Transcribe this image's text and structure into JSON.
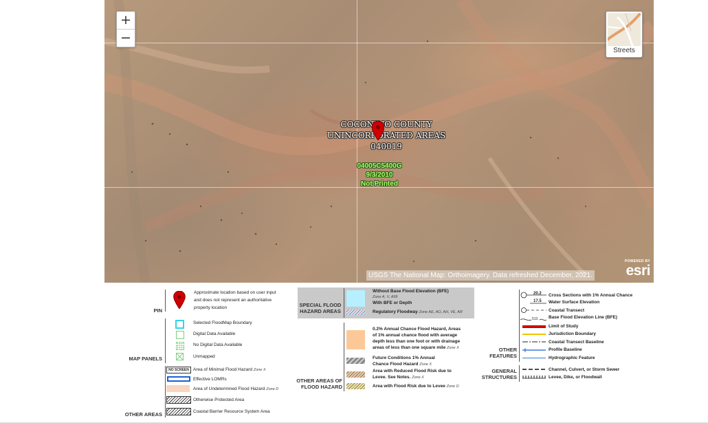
{
  "map": {
    "zoom_in": "+",
    "zoom_out": "−",
    "basemap_toggle_label": "Streets",
    "county_label": [
      "COCONINO COUNTY",
      "UNINCORPORATED AREAS",
      "040019"
    ],
    "panel_label": [
      "04005C5400G",
      "9/3/2010",
      "Not Printed"
    ],
    "attribution": "USGS The National Map: Orthoimagery. Data refreshed December, 2021.",
    "esri_powered_by": "POWERED BY",
    "esri_wordmark": "esri"
  },
  "legend": {
    "pin": {
      "section": "PIN",
      "text": [
        "Approximate location based on user input",
        "and does not represent an authoritative",
        "property location"
      ]
    },
    "map_panels": {
      "section": "MAP PANELS",
      "items": [
        "Selected FloodMap Boundary",
        "Digital Data Available",
        "No Digital Data Available",
        "Unmapped"
      ]
    },
    "other_areas": {
      "section": "OTHER AREAS",
      "no_screen_label": "NO SCREEN",
      "items": [
        {
          "text": "Area of Minimal Flood Hazard",
          "zone": "Zone X"
        },
        {
          "text": "Effective LOMRs",
          "zone": ""
        },
        {
          "text": "Area of Undetermined Flood Hazard",
          "zone": "Zone D"
        },
        {
          "text": "Otherwise Protected Area",
          "zone": ""
        },
        {
          "text": "Coastal Barrier Resource System Area",
          "zone": ""
        }
      ]
    },
    "special_flood": {
      "section": [
        "SPECIAL FLOOD",
        "HAZARD AREAS"
      ],
      "items": [
        {
          "text": "Without Base Flood Elevation (BFE)",
          "zone": "Zone A, V, A99"
        },
        {
          "text": "With BFE or Depth",
          "zone": ""
        },
        {
          "text": "Regulatory Floodway",
          "zone": "Zone AE, AO, AH, VE, AR"
        }
      ]
    },
    "other_flood": {
      "section": [
        "OTHER AREAS OF",
        "FLOOD HAZARD"
      ],
      "items": [
        {
          "lines": [
            "0.2% Annual Chance Flood Hazard, Areas",
            "of 1% annual chance flood with average",
            "depth less than one foot or with drainage",
            "areas of less than one square mile"
          ],
          "zone": "Zone X"
        },
        {
          "lines": [
            "Future Conditions 1% Annual",
            "Chance Flood Hazard"
          ],
          "zone": "Zone X"
        },
        {
          "lines": [
            "Area with Reduced Flood Risk due to",
            "Levee. See Notes."
          ],
          "zone": "Zone X"
        },
        {
          "lines": [
            "Area with Flood Risk due to Levee"
          ],
          "zone": "Zone D"
        }
      ]
    },
    "other_features": {
      "section": [
        "OTHER",
        "FEATURES"
      ],
      "sample_cross_section": "20.2",
      "sample_wse": "17.5",
      "sample_bfe": "513",
      "items": [
        "Cross Sections with 1% Annual Chance",
        "Water Surface Elevation",
        "Coastal Transect",
        "Base Flood Elevation Line (BFE)",
        "Limit of Study",
        "Jurisdiction Boundary",
        "Coastal Transect Baseline",
        "Profile Baseline",
        "Hydrographic Feature"
      ]
    },
    "general_structures": {
      "section": [
        "GENERAL",
        "STRUCTURES"
      ],
      "items": [
        "Channel, Culvert, or Storm Sewer",
        "Levee, Dike, or Floodwall"
      ]
    }
  }
}
